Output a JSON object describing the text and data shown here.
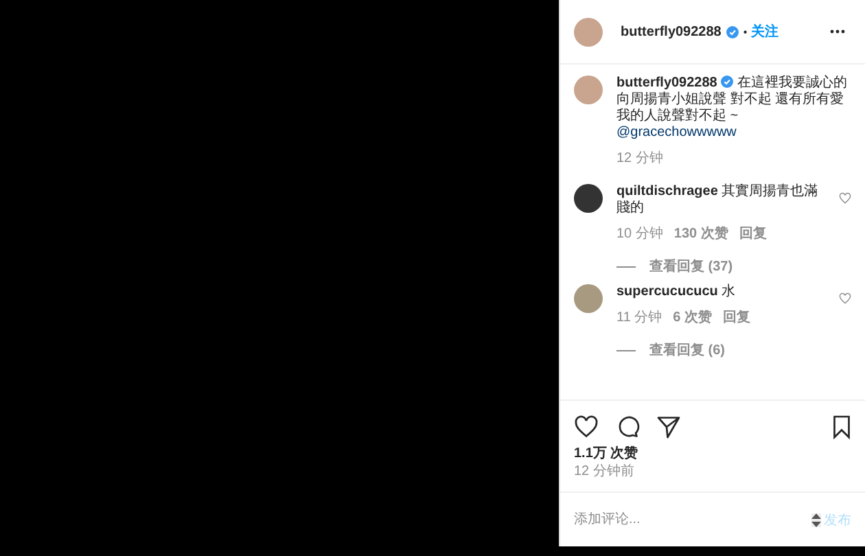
{
  "header": {
    "username": "butterfly092288",
    "verified": true,
    "separator": "•",
    "follow": "关注"
  },
  "caption": {
    "username": "butterfly092288",
    "verified": true,
    "text": "在這裡我要誠心的向周揚青小姐說聲 對不起 還有所有愛我的人說聲對不起 ~",
    "mention": "@gracechowwwww",
    "time": "12 分钟"
  },
  "comments": [
    {
      "username": "quiltdischragee",
      "text": "其實周揚青也滿賤的",
      "time": "10 分钟",
      "likes": "130 次赞",
      "reply": "回复",
      "view_replies": "查看回复 (37)",
      "liked": false
    },
    {
      "username": "supercucucucu",
      "text": "水",
      "time": "11 分钟",
      "likes": "6 次赞",
      "reply": "回复",
      "view_replies": "查看回复 (6)",
      "liked": false
    }
  ],
  "likes": "1.1万 次赞",
  "posted": "12 分钟前",
  "saved": false,
  "comment_field": {
    "placeholder": "添加评论..."
  },
  "post_button": "发布"
}
